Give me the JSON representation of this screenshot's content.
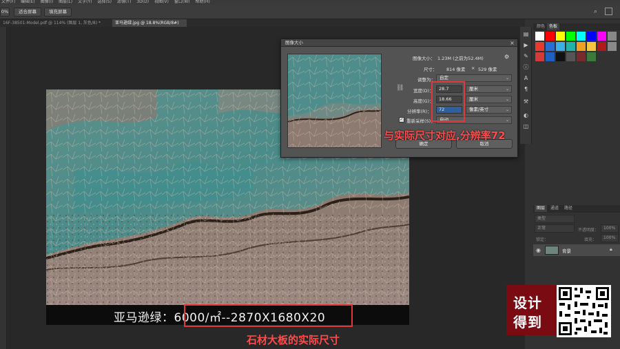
{
  "menu": [
    "文件(F)",
    "编辑(E)",
    "图像(I)",
    "图层(L)",
    "文字(Y)",
    "选择(S)",
    "滤镜(T)",
    "3D(D)",
    "视图(V)",
    "窗口(W)",
    "帮助(H)"
  ],
  "options": {
    "zoom": "0%",
    "fit_screen": "适合屏幕",
    "fill_screen": "填充屏幕"
  },
  "tabs": [
    {
      "label": "16F-38501-Model.pdf @ 114% (图层 1, 灰色/8) *"
    },
    {
      "label": "亚马逊绿.jpg @ 18.8%(RGB/8#)"
    }
  ],
  "dialog": {
    "title": "图像大小",
    "image_size_label": "图像大小：",
    "image_size_value": "1.23M (之前为52.4M)",
    "dimensions_label": "尺寸：",
    "dimensions_w": "814 像素",
    "dimensions_x": "×",
    "dimensions_h": "529 像素",
    "fit_label": "调整为：",
    "fit_value": "自定",
    "width_label": "宽度(D)：",
    "width_value": "28.7",
    "width_unit": "厘米",
    "height_label": "高度(G)：",
    "height_value": "18.66",
    "height_unit": "厘米",
    "res_label": "分辨率(R)：",
    "res_value": "72",
    "res_unit": "像素/英寸",
    "resample_label": "重新采样(S)：",
    "resample_value": "自动",
    "ok": "确定",
    "cancel": "取消"
  },
  "annotations": {
    "dialog_note": "与实际尺寸对应,分辨率72",
    "caption": "亚马逊绿：6000/㎡--2870X1680X20",
    "caption_note": "石材大板的实际尺寸"
  },
  "panels": {
    "color_tab": "颜色",
    "swatch_tab": "色板",
    "layers_tab": "图层",
    "channels_tab": "通道",
    "paths_tab": "路径",
    "kind_filter": "类型",
    "blend_mode": "正常",
    "opacity_label": "不透明度：",
    "opacity_value": "100%",
    "lock_label": "锁定：",
    "fill_label": "填充：",
    "fill_value": "100%",
    "layer_name": "背景"
  },
  "swatches": [
    "#ffffff",
    "#ff0000",
    "#ffff00",
    "#00ff00",
    "#00ffff",
    "#0000ff",
    "#ff00ff",
    "#888888",
    "#e83a2e",
    "#2b6cd3",
    "#3bb0e6",
    "#22b2a8",
    "#f0a020",
    "#f6c542",
    "#b01a1a",
    "#8a8a8a",
    "#d43a3a",
    "#1e5fbf",
    "#111111",
    "#555555",
    "#7a2a2a",
    "#3b7a3b"
  ],
  "logo": {
    "line1": "设计",
    "line2": "得到"
  }
}
